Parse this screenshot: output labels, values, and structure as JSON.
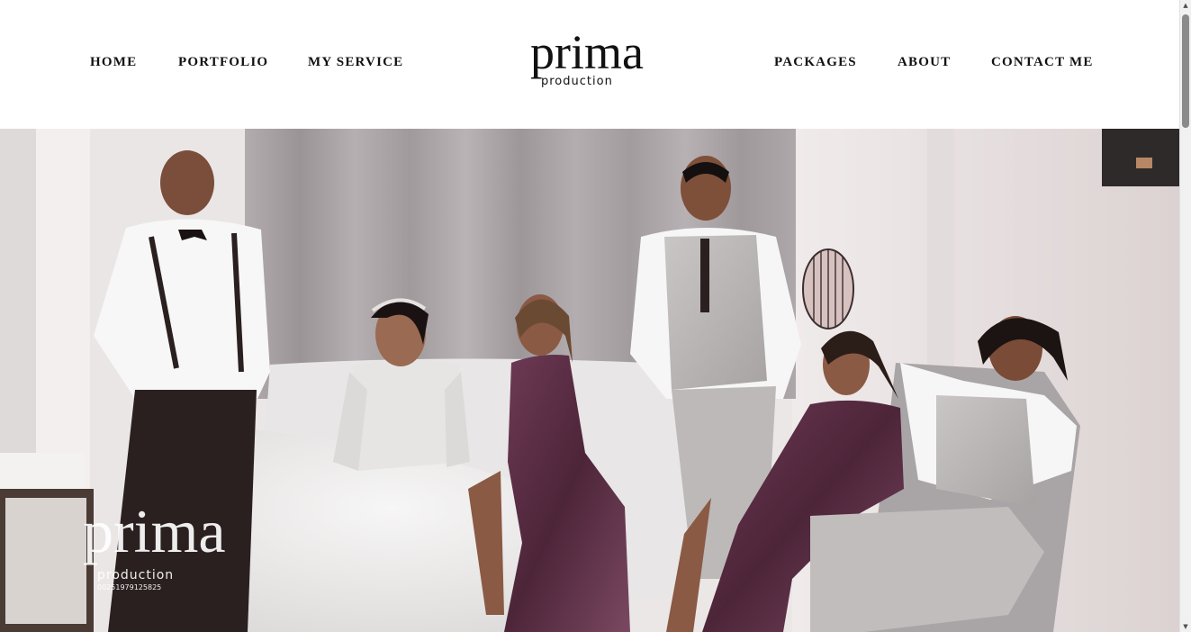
{
  "nav": {
    "left": [
      {
        "label": "HOME"
      },
      {
        "label": "PORTFOLIO"
      },
      {
        "label": "MY SERVICE"
      }
    ],
    "right": [
      {
        "label": "PACKAGES"
      },
      {
        "label": "ABOUT"
      },
      {
        "label": "CONTACT ME"
      }
    ]
  },
  "logo": {
    "word": "prima",
    "sub": "production"
  },
  "hero": {
    "alt": "Wedding party group photo",
    "watermark": {
      "word": "prima",
      "sub": "production",
      "phone": "00251979125825"
    }
  },
  "colors": {
    "nav_text": "#111111",
    "header_bg": "#ffffff",
    "dress": "#5b2e45",
    "curtain": "#a9a2a4",
    "wall": "#ece7e7"
  }
}
